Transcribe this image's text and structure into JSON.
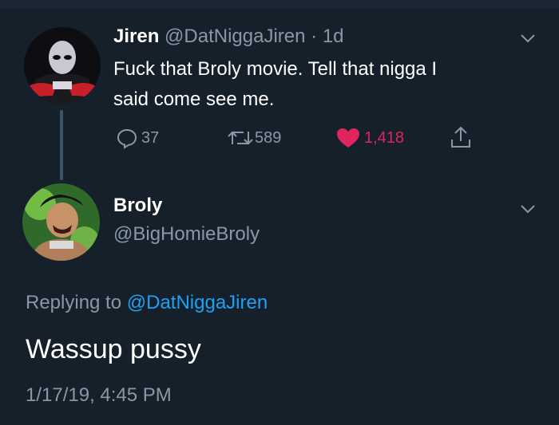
{
  "tweet1": {
    "name": "Jiren",
    "handle": "@DatNiggaJiren",
    "time": "· 1d",
    "text_line1": "Fuck that Broly movie. Tell that nigga I",
    "text_line2": "said come see me.",
    "replies": "37",
    "retweets": "589",
    "likes": "1,418",
    "like_color": "#e0245e"
  },
  "tweet2": {
    "name": "Broly",
    "handle": "@BigHomieBroly",
    "replying_prefix": "Replying to",
    "replying_handle": "@DatNiggaJiren",
    "text": "Wassup pussy",
    "timestamp": "1/17/19, 4:45 PM"
  },
  "icons": [
    "reply-icon",
    "retweet-icon",
    "heart-icon",
    "share-icon",
    "chevron-down-icon"
  ]
}
